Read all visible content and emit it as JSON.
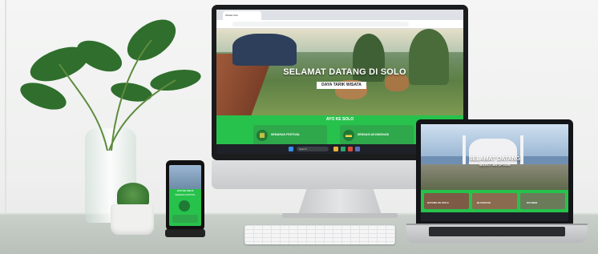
{
  "monitor": {
    "browser_tab": "Wisata Solo",
    "hero_title": "SELAMAT DATANG DI SOLO",
    "hero_button": "DAYA TARIK WISATA",
    "section_title": "AYO KE SOLO",
    "cards": [
      {
        "label": "SEMARAK FESTIVAL",
        "icon": "calendar-icon"
      },
      {
        "label": "SENSASI AKOMODASI",
        "icon": "bed-icon"
      }
    ],
    "taskbar_search": "Search"
  },
  "laptop": {
    "hero_title": "SELAMAT DATANG",
    "hero_sub": "SELECT AN OPTION",
    "thumbs": [
      {
        "label": "DATANG KE SOLO"
      },
      {
        "label": "BLUSUKAN"
      },
      {
        "label": "KULINER"
      }
    ]
  },
  "phone": {
    "title": "AYO KE SOLO",
    "subtitle": "SEMARAK FESTIVAL"
  },
  "colors": {
    "accent_green": "#27c24c",
    "dark_green": "#1f7a35"
  }
}
